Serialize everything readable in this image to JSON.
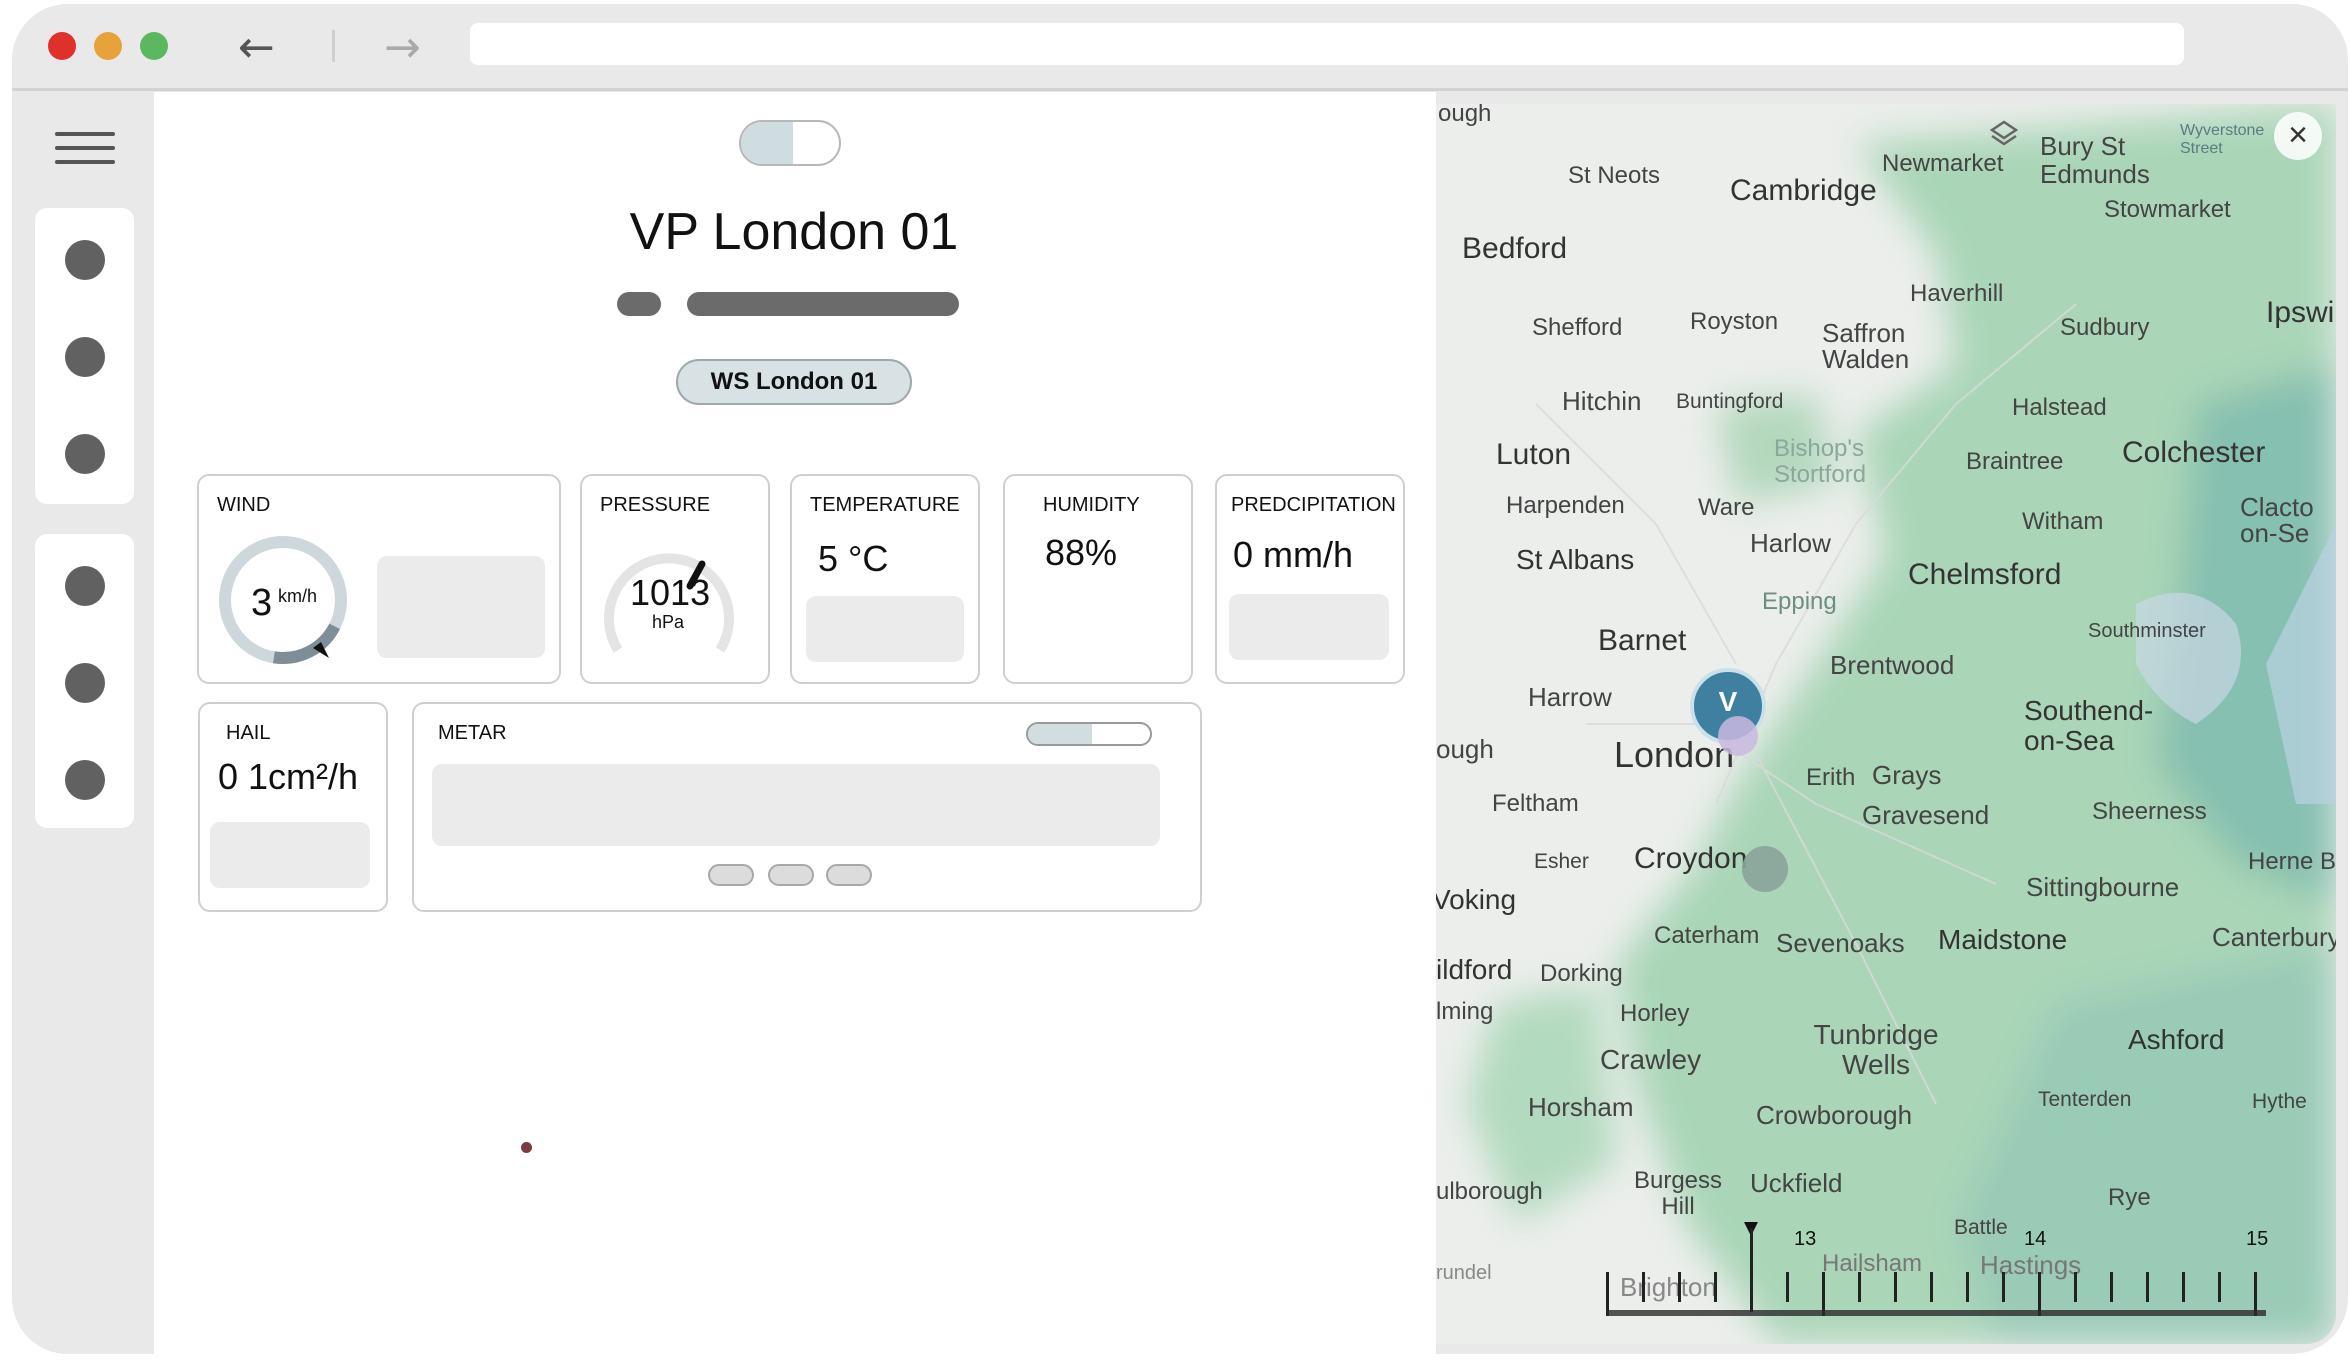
{
  "window": {
    "traffic_colors": [
      "#e0302a",
      "#e8a23a",
      "#5cb860"
    ]
  },
  "nav": {
    "back_icon": "←",
    "forward_icon": "→"
  },
  "header": {
    "title": "VP London 01",
    "station_chip": "WS London 01"
  },
  "cards": {
    "wind": {
      "label": "WIND",
      "value": "3",
      "unit": "km/h",
      "gauge_fraction": 0.2
    },
    "pressure": {
      "label": "PRESSURE",
      "value": "1013",
      "unit": "hPa"
    },
    "temperature": {
      "label": "TEMPERATURE",
      "value": "5 °C"
    },
    "humidity": {
      "label": "HUMIDITY",
      "value": "88%"
    },
    "precipitation": {
      "label": "PREDCIPITATION",
      "value": "0 mm/h"
    },
    "hail": {
      "label": "HAIL",
      "value": "0 1cm²/h"
    },
    "metar": {
      "label": "METAR"
    }
  },
  "map": {
    "close_icon": "×",
    "layers_icon": "layers-icon",
    "pin_letter": "V",
    "places": [
      "ough",
      "St Neots",
      "Cambridge",
      "Newmarket",
      "Bury St Edmunds",
      "Wyverstone Street",
      "Stowmarket",
      "Bedford",
      "Haverhill",
      "Shefford",
      "Royston",
      "Saffron Walden",
      "Sudbury",
      "Ipswi",
      "Hitchin",
      "Buntingford",
      "Halstead",
      "Luton",
      "Bishop's Stortford",
      "Braintree",
      "Colchester",
      "Harpenden",
      "Ware",
      "Witham",
      "Clacto on-Se",
      "Harlow",
      "St Albans",
      "Chelmsford",
      "Epping",
      "Barnet",
      "Southminster",
      "Brentwood",
      "Harrow",
      "Southend-on-Sea",
      "ough",
      "London",
      "Erith",
      "Grays",
      "Feltham",
      "Gravesend",
      "Sheerness",
      "Esher",
      "Croydon",
      "Herne B",
      "Sittingbourne",
      "Voking",
      "Caterham",
      "Sevenoaks",
      "Maidstone",
      "Canterbury",
      "ildford",
      "Dorking",
      "lming",
      "Horley",
      "Tunbridge Wells",
      "Ashford",
      "Crawley",
      "Horsham",
      "Crowborough",
      "Tenterden",
      "Hythe",
      "ulborough",
      "Burgess Hill",
      "Uckfield",
      "Rye",
      "Battle",
      "Hailsham",
      "Hastings",
      "Brighton",
      "rundel"
    ],
    "timeline": [
      "13",
      "14",
      "15"
    ]
  }
}
